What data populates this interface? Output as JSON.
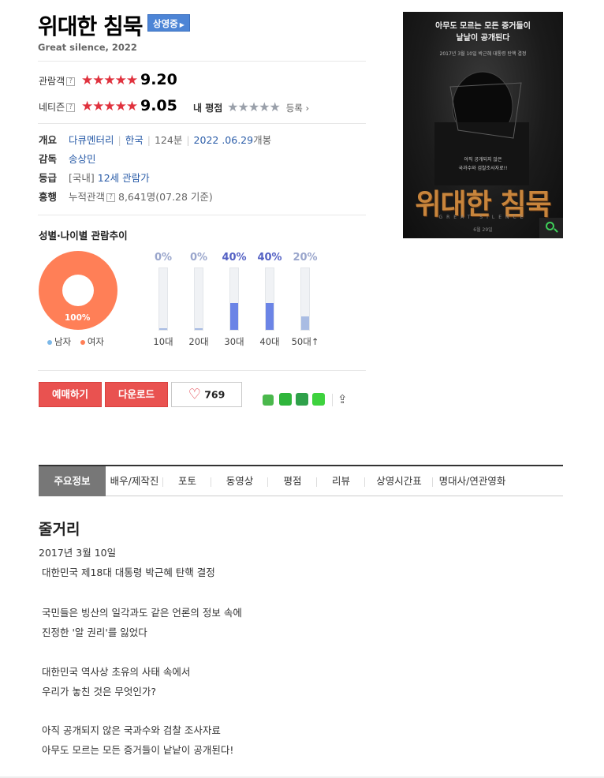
{
  "movie": {
    "title": "위대한 침묵",
    "status_badge": "상영중",
    "subtitle": "Great silence, 2022"
  },
  "ratings": {
    "audience_label": "관람객",
    "audience_stars": "★★★★★",
    "audience_score": "9.20",
    "netizen_label": "네티즌",
    "netizen_stars": "★★★★★",
    "netizen_score": "9.05",
    "my_rating_label": "내 평점",
    "my_rating_stars": "★★★★★",
    "register_label": "등록"
  },
  "info": {
    "overview_label": "개요",
    "genre": "다큐멘터리",
    "country": "한국",
    "runtime": "124분",
    "release_date": "2022 .06.29",
    "release_suffix": "개봉",
    "director_label": "감독",
    "director": "송상민",
    "grade_label": "등급",
    "grade_prefix": "[국내]",
    "grade": "12세 관람가",
    "box_label": "흥행",
    "box_prefix": "누적관객",
    "box_value": "8,641명(07.28 기준)"
  },
  "chart_section_title": "성별·나이별 관람추이",
  "chart_data": [
    {
      "type": "pie",
      "categories": [
        "남자",
        "여자"
      ],
      "values": [
        0,
        100
      ],
      "labels": [
        "100%"
      ],
      "colors": [
        "#7cb8e8",
        "#ff7f57"
      ]
    },
    {
      "type": "bar",
      "categories": [
        "10대",
        "20대",
        "30대",
        "40대",
        "50대↑"
      ],
      "values": [
        0,
        0,
        40,
        40,
        20
      ],
      "labels": [
        "0%",
        "0%",
        "40%",
        "40%",
        "20%"
      ],
      "ylim": [
        0,
        100
      ],
      "colors": {
        "max": "#6b84e6",
        "default": "#a9bce3",
        "max_label": "#5461c4",
        "default_label": "#9aa6cc"
      }
    }
  ],
  "buttons": {
    "reserve": "예매하기",
    "download": "다운로드",
    "like_count": "769"
  },
  "tabs": [
    "주요정보",
    "배우/제작진",
    "포토",
    "동영상",
    "평점",
    "리뷰",
    "상영시간표",
    "명대사/연관영화"
  ],
  "story": {
    "heading": "줄거리",
    "date": "2017년 3월 10일",
    "lines": [
      "대한민국 제18대 대통령 박근혜 탄핵 결정",
      "국민들은 빙산의 일각과도 같은 언론의 정보 속에",
      "진정한 '알 권리'를 잃었다",
      "대한민국 역사상 초유의 사태 속에서",
      "우리가 놓친 것은 무엇인가?",
      "아직 공개되지 않은 국과수와 검찰 조사자료",
      "아무도 모르는 모든 증거들이 낱낱이 공개된다!"
    ]
  },
  "poster": {
    "tagline1": "아무도 모르는 모든 증거들이",
    "tagline2": "낱낱이 공개된다",
    "caption": "2017년 3월 10일 박근혜 대통령 탄핵 결정",
    "small1": "아직 공개되지 않은",
    "small2": "국과수와 검찰조사자료!!",
    "title": "위대한 침묵",
    "english": "GREAT SILENCE",
    "date": "6월 29일"
  },
  "colors": {
    "accent_red": "#e95250",
    "link_blue": "#2a5ca8",
    "badge_blue": "#4d85d6"
  }
}
